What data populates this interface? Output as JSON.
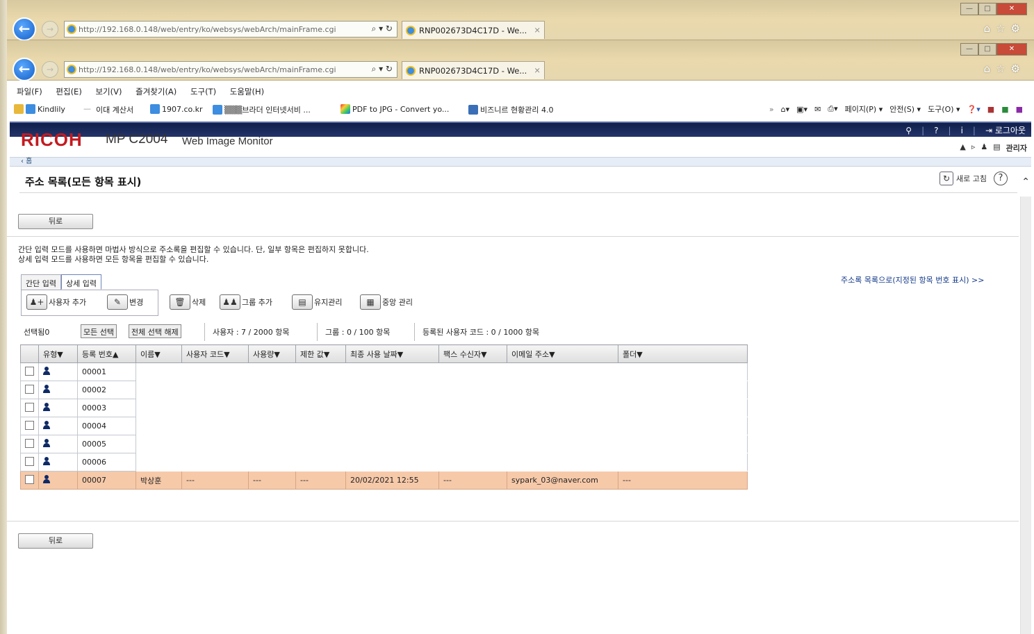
{
  "browser": {
    "url": "http://192.168.0.148/web/entry/ko/websys/webArch/mainFrame.cgi",
    "url_controls": "⌕ ▾ ↻",
    "tab_title": "RNP002673D4C17D - We...",
    "tab_close": "×",
    "menu": [
      "파일(F)",
      "편집(E)",
      "보기(V)",
      "즐겨찾기(A)",
      "도구(T)",
      "도움말(H)"
    ],
    "favorites": [
      "Kindlily",
      "이대 계산서",
      "1907.co.kr",
      "▒▒▒브라더 인터넷서비 ...",
      "PDF to JPG - Convert yo...",
      "비즈니르 현황관리 4.0"
    ],
    "favorites_sep": "—",
    "more": "»",
    "commands": [
      "페이지(P) ▾",
      "안전(S) ▾",
      "도구(O) ▾"
    ]
  },
  "header": {
    "brand": "RICOH",
    "model": "MP C2004",
    "app": "Web Image Monitor",
    "logout": "로그아웃",
    "user_role": "관리자",
    "home_crumb": "‹ 홈"
  },
  "page": {
    "title": "주소 목록(모든 항목 표시)",
    "refresh": "새로 고침",
    "back_top": "뒤로",
    "back_bottom": "뒤로",
    "note_line1": "간단 입력 모드를 사용하면 마법사 방식으로 주소록을 편집할 수 있습니다. 단, 일부 항목은 편집하지 못합니다.",
    "note_line2": "상세 입력 모드를 사용하면 모든 항목을 편집할 수 있습니다.",
    "list_link": "주소록 목록으로(지정된 항목 번호 표시) >>",
    "tab_simple": "간단 입력",
    "tab_detail": "상세 입력",
    "tools": {
      "add_user": "사용자 추가",
      "edit": "변경",
      "delete": "삭제",
      "add_group": "그룹 추가",
      "maintenance": "유지관리",
      "central": "중앙 관리"
    },
    "selected": "선택됨0",
    "select_all": "모든 선택",
    "deselect_all": "전체 선택 해제",
    "users_count": "사용자 : 7 / 2000 항목",
    "groups_count": "그룹 : 0 / 100 항목",
    "codes_count": "등록된 사용자 코드 : 0 / 1000 항목"
  },
  "table": {
    "columns": [
      "",
      "유형▼",
      "등록 번호▲",
      "이름▼",
      "사용자 코드▼",
      "사용량▼",
      "제한 값▼",
      "최종 사용 날짜▼",
      "팩스 수신자▼",
      "이메일 주소▼",
      "폴더▼"
    ],
    "rows": [
      {
        "num": "00001"
      },
      {
        "num": "00002"
      },
      {
        "num": "00003"
      },
      {
        "num": "00004"
      },
      {
        "num": "00005"
      },
      {
        "num": "00006"
      },
      {
        "num": "00007",
        "name": "박상훈",
        "code": "---",
        "usage": "---",
        "limit": "---",
        "last": "20/02/2021 12:55",
        "fax": "---",
        "email": "sypark_03@naver.com",
        "folder": "---"
      }
    ]
  },
  "colors": {
    "brand": "#c41a20",
    "selected_row": "#f6c9a9",
    "topbar": "#1a2a5c"
  }
}
